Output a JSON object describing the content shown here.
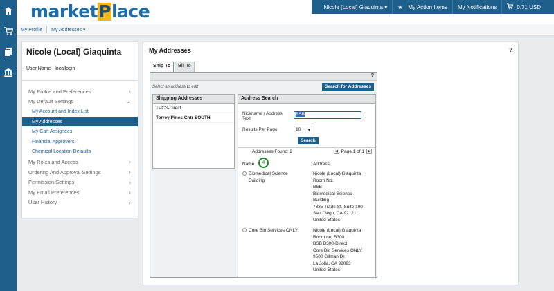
{
  "app": {
    "logo_part1": "market",
    "logo_part2": "P",
    "logo_part3": "lace"
  },
  "topbar": {
    "user": "Nicole (Local) Giaquinta",
    "action_items": "My Action Items",
    "notifications": "My Notifications",
    "cart_amount": "0.71 USD"
  },
  "breadcrumb": {
    "profile": "My Profile",
    "addresses": "My Addresses"
  },
  "sidebar": {
    "user_name": "Nicole (Local) Giaquinta",
    "username_label": "User Name",
    "username_value": "locallogin",
    "items": [
      {
        "label": "My Profile and Preferences",
        "sub": false,
        "chevron": "right"
      },
      {
        "label": "My Default Settings",
        "sub": false,
        "chevron": "down"
      },
      {
        "label": "My Account and Index List",
        "sub": true
      },
      {
        "label": "My Addresses",
        "sub": true,
        "active": true
      },
      {
        "label": "My Cart Assignees",
        "sub": true
      },
      {
        "label": "Financial Approvers",
        "sub": true
      },
      {
        "label": "Chemical Location Defaults",
        "sub": true
      },
      {
        "label": "My Roles and Access",
        "sub": false,
        "chevron": "right"
      },
      {
        "label": "Ordering And Approval Settings",
        "sub": false,
        "chevron": "right"
      },
      {
        "label": "Permission Settings",
        "sub": false,
        "chevron": "right"
      },
      {
        "label": "My Email Preferences",
        "sub": false,
        "chevron": "right"
      },
      {
        "label": "User History",
        "sub": false,
        "chevron": "right"
      }
    ]
  },
  "main": {
    "title": "My Addresses",
    "help": "?",
    "tabs": [
      {
        "label": "Ship To",
        "active": true
      },
      {
        "label": "Bill To",
        "active": false
      }
    ],
    "panel_help": "?",
    "select_hint": "Select an address to edit",
    "search_for_addresses_btn": "Search for Addresses",
    "shipping_addresses": {
      "header": "Shipping Addresses",
      "items": [
        {
          "label": "TPCS-Direct",
          "bold": false
        },
        {
          "label": "Torrey Pines Cntr SOUTH",
          "bold": true
        }
      ]
    },
    "address_search": {
      "header": "Address Search",
      "nickname_label_1": "Nickname / Address",
      "nickname_label_2": "Text",
      "nickname_value": "BSB",
      "results_per_page_label": "Results Per Page",
      "results_per_page_value": "10",
      "search_btn": "Search",
      "found": "Addresses Found: 2",
      "page": "Page 1 of 1",
      "col_name": "Name",
      "col_address": "Address",
      "step_badge": "4",
      "results": [
        {
          "name": [
            "Biomedical Science",
            "Building"
          ],
          "address": [
            "Nicole (Local) Giaquinta",
            "Room No.",
            "BSB",
            "Biomedical Science",
            "Building",
            "7835 Trade St. Suite 100",
            "San Diego, CA 92121",
            "United States"
          ]
        },
        {
          "name": [
            "Core Bio Services ONLY"
          ],
          "address": [
            "Nicole (Local) Giaquinta",
            "Room no. B300",
            "BSB B300-Direct",
            "Core Bio Services ONLY",
            "9500 Gilman Dr.",
            "La Jolla, CA 92093",
            "United States"
          ]
        }
      ]
    }
  },
  "colors": {
    "brand": "#1f5f8b",
    "logo_accent": "#f6b51b",
    "step": "#1f8a2a"
  }
}
